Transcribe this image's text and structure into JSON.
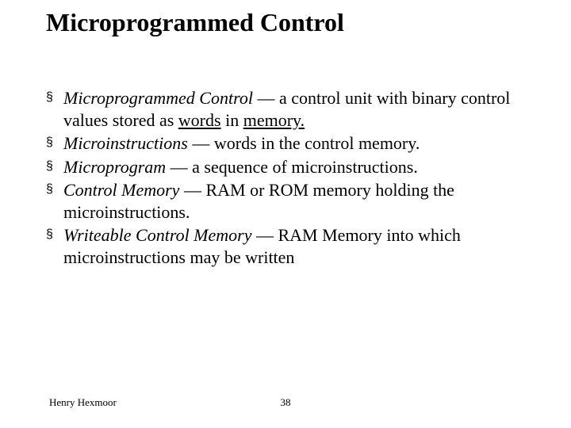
{
  "slide": {
    "title": "Microprogrammed Control",
    "bullets": [
      {
        "term": "Microprogrammed Control",
        "pre": " — a control unit with binary control values stored as ",
        "u1": "words",
        "mid": " in ",
        "u2": "memory.",
        "post": ""
      },
      {
        "term": "Microinstructions",
        "pre": " — words in the control memory.",
        "u1": "",
        "mid": "",
        "u2": "",
        "post": ""
      },
      {
        "term": "Microprogram",
        "pre": " — a sequence of microinstructions.",
        "u1": "",
        "mid": "",
        "u2": "",
        "post": ""
      },
      {
        "term": "Control Memory",
        "pre": " — RAM or ROM memory holding the microinstructions.",
        "u1": "",
        "mid": "",
        "u2": "",
        "post": ""
      },
      {
        "term": "Writeable Control Memory",
        "pre": " — RAM Memory into which microinstructions may be written",
        "u1": "",
        "mid": "",
        "u2": "",
        "post": ""
      }
    ],
    "bullet_char": "§"
  },
  "footer": {
    "author": "Henry Hexmoor",
    "page": "38"
  }
}
